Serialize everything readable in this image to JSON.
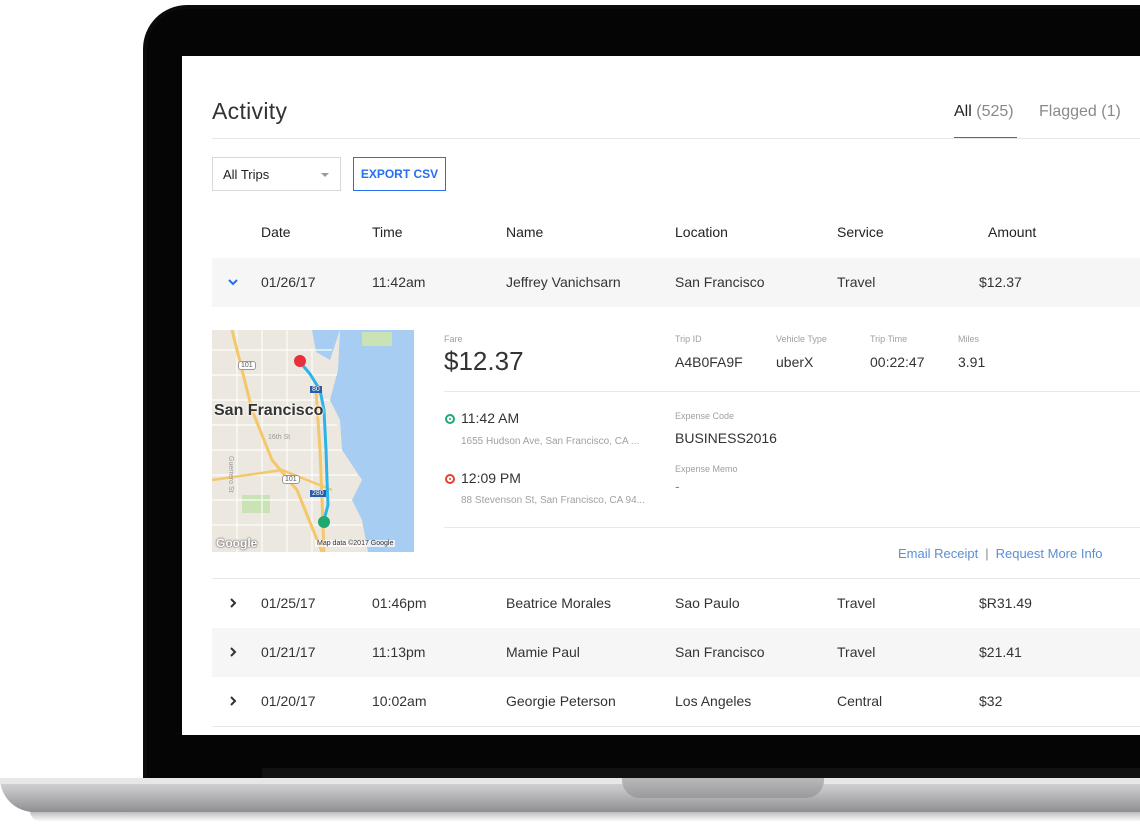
{
  "page": {
    "title": "Activity",
    "tabs": [
      {
        "label": "All",
        "count": "(525)"
      },
      {
        "label": "Flagged",
        "count": "(1)"
      }
    ]
  },
  "filters": {
    "trip_filter": "All Trips",
    "export_label": "EXPORT CSV"
  },
  "columns": [
    "Date",
    "Time",
    "Name",
    "Location",
    "Service",
    "Amount"
  ],
  "rows": [
    {
      "date": "01/26/17",
      "time": "11:42am",
      "name": "Jeffrey Vanichsarn",
      "location": "San Francisco",
      "service": "Travel",
      "amount": "$12.37",
      "expanded": true
    },
    {
      "date": "01/25/17",
      "time": "01:46pm",
      "name": "Beatrice Morales",
      "location": "Sao Paulo",
      "service": "Travel",
      "amount": "$R31.49"
    },
    {
      "date": "01/21/17",
      "time": "11:13pm",
      "name": "Mamie Paul",
      "location": "San Francisco",
      "service": "Travel",
      "amount": "$21.41"
    },
    {
      "date": "01/20/17",
      "time": "10:02am",
      "name": "Georgie Peterson",
      "location": "Los Angeles",
      "service": "Central",
      "amount": "$32"
    }
  ],
  "detail": {
    "fare_label": "Fare",
    "fare": "$12.37",
    "trip_id_label": "Trip ID",
    "trip_id": "A4B0FA9F",
    "vehicle_type_label": "Vehicle Type",
    "vehicle_type": "uberX",
    "trip_time_label": "Trip Time",
    "trip_time": "00:22:47",
    "miles_label": "Miles",
    "miles": "3.91",
    "pickup_time": "11:42 AM",
    "pickup_address": "1655 Hudson Ave, San Francisco, CA ...",
    "dropoff_time": "12:09 PM",
    "dropoff_address": "88 Stevenson St, San Francisco, CA 94...",
    "expense_code_label": "Expense Code",
    "expense_code": "BUSINESS2016",
    "expense_memo_label": "Expense Memo",
    "expense_memo": "-",
    "email_receipt": "Email Receipt",
    "separator": "|",
    "request_more_info": "Request More Info"
  },
  "map": {
    "city_label": "San Francisco",
    "street_label": "16th St",
    "street_label_2": "Guerrero St",
    "hwy_101": "101",
    "hwy_80": "80",
    "hwy_280": "280",
    "google": "Google",
    "attribution": "Map data ©2017 Google"
  },
  "colors": {
    "accent": "#276ef1",
    "route": "#2bb5e6",
    "start_pin": "#e8303c",
    "end_pin": "#1fa971"
  }
}
